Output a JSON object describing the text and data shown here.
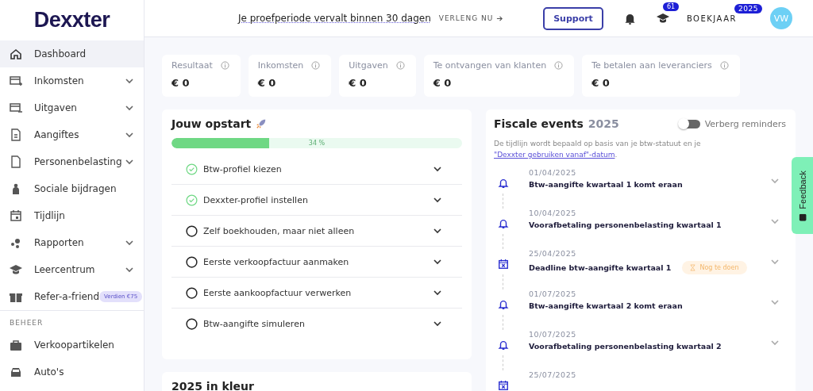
{
  "logo": "Dexxter",
  "sidebar": {
    "items": [
      {
        "label": "Dashboard",
        "kind": "home",
        "selected": true,
        "has_submenu": false
      },
      {
        "label": "Inkomsten",
        "kind": "card-plus",
        "selected": false,
        "has_submenu": true
      },
      {
        "label": "Uitgaven",
        "kind": "card-minus",
        "selected": false,
        "has_submenu": true
      },
      {
        "label": "Aangiftes",
        "kind": "doc",
        "selected": false,
        "has_submenu": true
      },
      {
        "label": "Personenbelasting",
        "kind": "page",
        "selected": false,
        "has_submenu": true
      },
      {
        "label": "Sociale bijdragen",
        "kind": "person",
        "selected": false,
        "has_submenu": false
      },
      {
        "label": "Tijdlijn",
        "kind": "calendar",
        "selected": false,
        "has_submenu": false
      },
      {
        "label": "Rapporten",
        "kind": "dots",
        "selected": false,
        "has_submenu": true
      },
      {
        "label": "Leercentrum",
        "kind": "cap",
        "selected": false,
        "has_submenu": true
      },
      {
        "label": "Refer-a-friend",
        "kind": "gift",
        "selected": false,
        "has_submenu": false,
        "badge": "Verdien €75"
      }
    ],
    "section": "BEHEER",
    "section_items": [
      {
        "label": "Verkoopartikelen",
        "kind": "briefcase",
        "selected": false,
        "has_submenu": false
      },
      {
        "label": "Auto's",
        "kind": "car",
        "selected": false,
        "has_submenu": false
      }
    ]
  },
  "topbar": {
    "trial": "Je proefperiode vervalt binnen 30 dagen",
    "extend": "VERLENG NU",
    "support": "Support",
    "learn_count": "61",
    "year_label": "BOEKJAAR",
    "year": "2025",
    "avatar": "VW"
  },
  "stats": [
    {
      "label": "Resultaat",
      "value": "€ 0"
    },
    {
      "label": "Inkomsten",
      "value": "€ 0"
    },
    {
      "label": "Uitgaven",
      "value": "€ 0"
    },
    {
      "label": "Te ontvangen van klanten",
      "value": "€ 0"
    },
    {
      "label": "Te betalen aan leveranciers",
      "value": "€ 0"
    }
  ],
  "startup": {
    "title": "Jouw opstart",
    "level": 0.335,
    "progress_label": "34 %",
    "steps": [
      {
        "label": "Btw-profiel kiezen",
        "done": true
      },
      {
        "label": "Dexxter-profiel instellen",
        "done": true
      },
      {
        "label": "Zelf boekhouden, maar niet alleen",
        "done": false
      },
      {
        "label": "Eerste verkoopfactuur aanmaken",
        "done": false
      },
      {
        "label": "Eerste aankoopfactuur verwerken",
        "done": false
      },
      {
        "label": "Btw-aangifte simuleren",
        "done": false
      }
    ]
  },
  "next_card": {
    "title": "2025 in kleur"
  },
  "fiscal": {
    "title": "Fiscale events",
    "year": "2025",
    "toggle_label": "Verberg reminders",
    "toggle_on": false,
    "intro": "De tijdlijn wordt bepaald op basis van je btw-statuut en je ",
    "intro_link": "\"Dexxter gebruiken vanaf\"-datum",
    "intro_end": ".",
    "events": [
      {
        "kind": "reminder",
        "date": "01/04/2025",
        "title": "Btw-aangifte kwartaal 1 komt eraan"
      },
      {
        "kind": "reminder",
        "date": "10/04/2025",
        "title": "Voorafbetaling personenbelasting kwartaal 1"
      },
      {
        "kind": "deadline",
        "date": "25/04/2025",
        "title": "Deadline btw-aangifte kwartaal 1",
        "badge": "Nog te doen"
      },
      {
        "kind": "reminder",
        "date": "01/07/2025",
        "title": "Btw-aangifte kwartaal 2 komt eraan"
      },
      {
        "kind": "reminder",
        "date": "10/07/2025",
        "title": "Voorafbetaling personenbelasting kwartaal 2"
      },
      {
        "kind": "deadline",
        "date": "25/07/2025"
      }
    ]
  },
  "feedback": "Feedback"
}
